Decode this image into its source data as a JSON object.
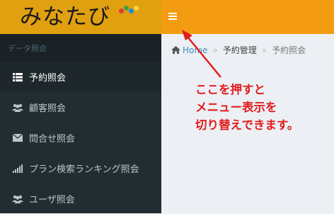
{
  "app": {
    "logo_text": "みなたび"
  },
  "colors": {
    "logo_bg": "#e0a010",
    "topbar_bg": "#f39c12",
    "sidebar_bg": "#222d32",
    "annotation_red": "#e31b1b",
    "logo_dot_colors": [
      "#e53935",
      "#43a047",
      "#1e88e5",
      "#fdd835"
    ]
  },
  "topbar": {
    "menu_icon": "hamburger-icon"
  },
  "sidebar": {
    "header": "データ照会",
    "items": [
      {
        "label": "予約照会",
        "icon": "list-icon",
        "active": true
      },
      {
        "label": "顧客照会",
        "icon": "users-icon",
        "active": false
      },
      {
        "label": "問合せ照会",
        "icon": "envelope-icon",
        "active": false
      },
      {
        "label": "プラン検索ランキング照会",
        "icon": "signal-icon",
        "active": false
      },
      {
        "label": "ユーザ照会",
        "icon": "users-icon",
        "active": false
      }
    ]
  },
  "breadcrumb": {
    "home": "Home",
    "items": [
      "予約管理",
      "予約照会"
    ]
  },
  "annotation": {
    "lines": [
      "ここを押すと",
      "メニュー表示を",
      "切り替えできます。"
    ]
  }
}
